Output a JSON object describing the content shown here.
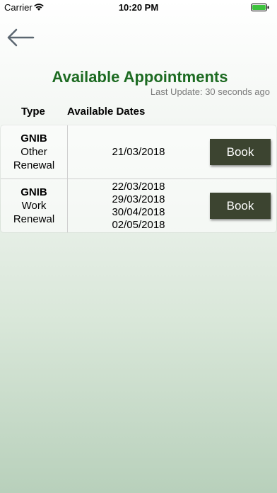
{
  "status_bar": {
    "carrier": "Carrier",
    "time": "10:20 PM"
  },
  "header": {
    "back_icon": "arrow-left-icon",
    "title": "Available Appointments",
    "last_update": "Last Update: 30 seconds ago"
  },
  "table": {
    "columns": [
      "Type",
      "Available Dates"
    ],
    "rows": [
      {
        "type_name": "GNIB",
        "type_line1": "Other",
        "type_line2": "Renewal",
        "dates": [
          "21/03/2018"
        ],
        "button_label": "Book"
      },
      {
        "type_name": "GNIB",
        "type_line1": "Work",
        "type_line2": "Renewal",
        "dates": [
          "22/03/2018",
          "29/03/2018",
          "30/04/2018",
          "02/05/2018"
        ],
        "button_label": "Book"
      }
    ]
  },
  "colors": {
    "title": "#1d6b22",
    "button": "#3c4430",
    "last_update": "#7b7b7b"
  }
}
